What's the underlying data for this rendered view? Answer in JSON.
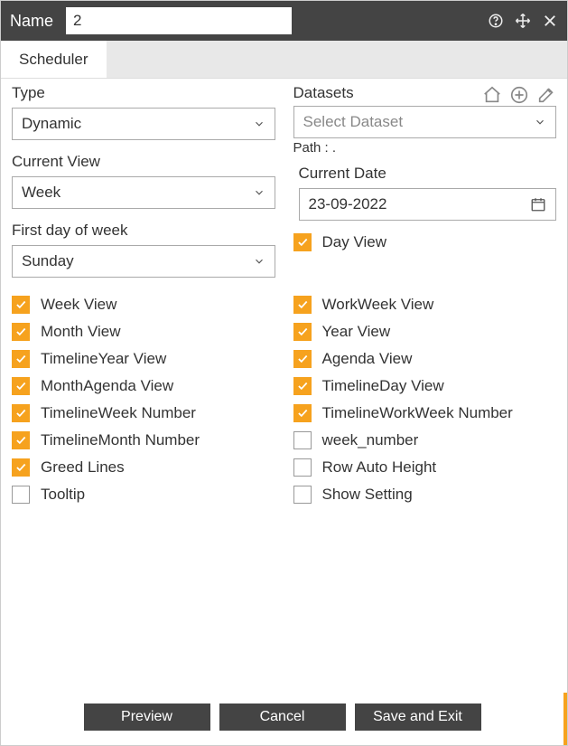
{
  "titlebar": {
    "name_label": "Name",
    "name_value": "2"
  },
  "tabs": {
    "scheduler": "Scheduler"
  },
  "left": {
    "type_label": "Type",
    "type_value": "Dynamic",
    "current_view_label": "Current View",
    "current_view_value": "Week",
    "first_day_label": "First day of week",
    "first_day_value": "Sunday"
  },
  "right": {
    "datasets_label": "Datasets",
    "dataset_placeholder": "Select Dataset",
    "path_label": "Path :",
    "path_value": ".",
    "current_date_label": "Current Date",
    "current_date_value": "23-09-2022",
    "day_view_label": "Day View"
  },
  "checks_left": [
    {
      "label": "Week View",
      "checked": true
    },
    {
      "label": "Month View",
      "checked": true
    },
    {
      "label": "TimelineYear View",
      "checked": true
    },
    {
      "label": "MonthAgenda View",
      "checked": true
    },
    {
      "label": "TimelineWeek Number",
      "checked": true
    },
    {
      "label": "TimelineMonth Number",
      "checked": true
    },
    {
      "label": "Greed Lines",
      "checked": true
    },
    {
      "label": "Tooltip",
      "checked": false
    }
  ],
  "checks_right": [
    {
      "label": "WorkWeek View",
      "checked": true
    },
    {
      "label": "Year View",
      "checked": true
    },
    {
      "label": "Agenda View",
      "checked": true
    },
    {
      "label": "TimelineDay View",
      "checked": true
    },
    {
      "label": "TimelineWorkWeek Number",
      "checked": true
    },
    {
      "label": "week_number",
      "checked": false
    },
    {
      "label": "Row Auto Height",
      "checked": false
    },
    {
      "label": "Show Setting",
      "checked": false
    }
  ],
  "footer": {
    "preview": "Preview",
    "cancel": "Cancel",
    "save": "Save and Exit"
  }
}
